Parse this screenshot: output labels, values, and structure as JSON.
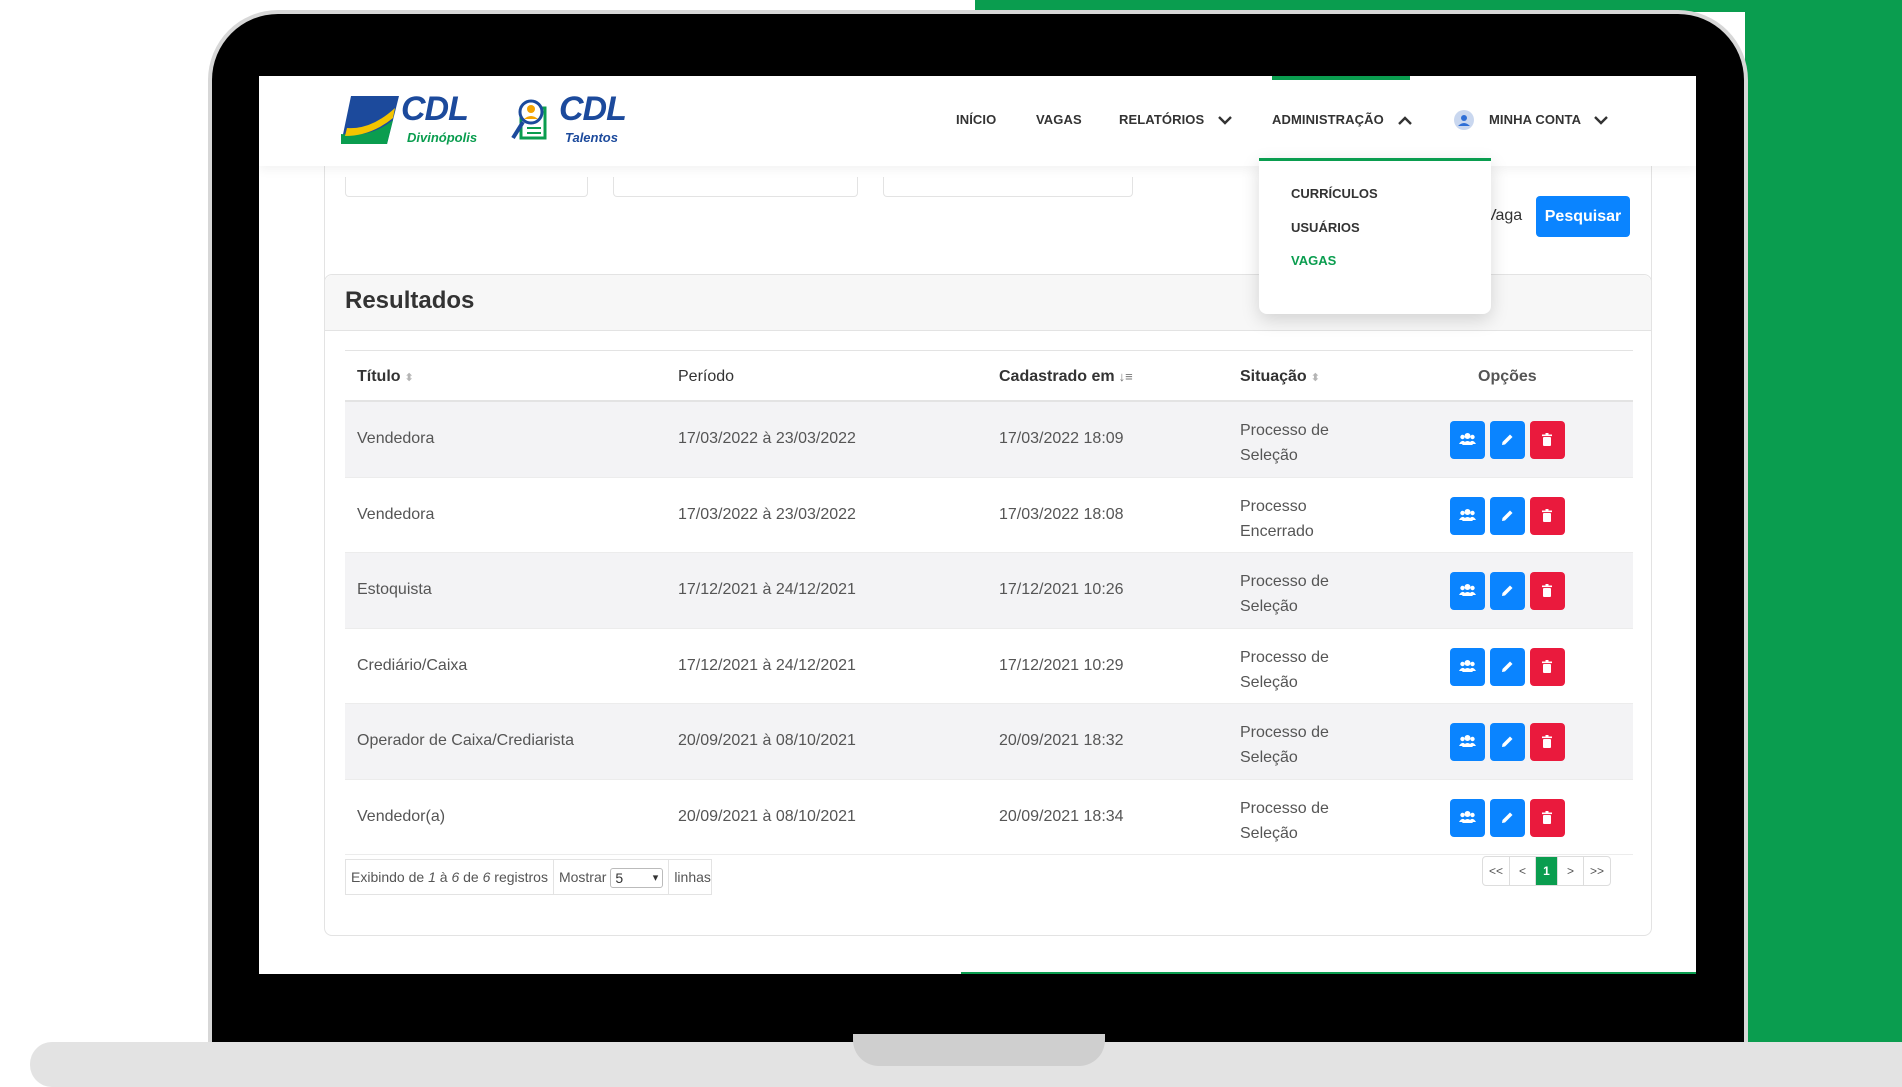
{
  "colors": {
    "brand_green": "#0a9d4f",
    "primary_blue": "#0a84ff",
    "danger_red": "#ea1a3d"
  },
  "logo": {
    "cdl1_text": "CDL",
    "cdl1_sub": "Divinópolis",
    "cdl2_text": "CDL",
    "cdl2_sub": "Talentos"
  },
  "nav": {
    "inicio": "INÍCIO",
    "vagas": "VAGAS",
    "relatorios": "RELATÓRIOS",
    "administracao": "ADMINISTRAÇÃO",
    "minha_conta": "MINHA CONTA"
  },
  "dropdown": {
    "items": [
      {
        "label": "CURRÍCULOS"
      },
      {
        "label": "USUÁRIOS"
      },
      {
        "label": "VAGAS",
        "active": true
      }
    ]
  },
  "filter": {
    "partial_label": "Vaga",
    "search_button": "Pesquisar"
  },
  "results": {
    "title": "Resultados",
    "columns": {
      "titulo": "Título",
      "periodo": "Período",
      "cadastrado": "Cadastrado em",
      "situacao": "Situação",
      "opcoes": "Opções"
    },
    "rows": [
      {
        "titulo": "Vendedora",
        "periodo": "17/03/2022 à 23/03/2022",
        "cadastrado": "17/03/2022 18:09",
        "situacao1": "Processo de",
        "situacao2": "Seleção"
      },
      {
        "titulo": "Vendedora",
        "periodo": "17/03/2022 à 23/03/2022",
        "cadastrado": "17/03/2022 18:08",
        "situacao1": "Processo",
        "situacao2": "Encerrado"
      },
      {
        "titulo": "Estoquista",
        "periodo": "17/12/2021 à 24/12/2021",
        "cadastrado": "17/12/2021 10:26",
        "situacao1": "Processo de",
        "situacao2": "Seleção"
      },
      {
        "titulo": "Crediário/Caixa",
        "periodo": "17/12/2021 à 24/12/2021",
        "cadastrado": "17/12/2021 10:29",
        "situacao1": "Processo de",
        "situacao2": "Seleção"
      },
      {
        "titulo": "Operador de Caixa/Crediarista",
        "periodo": "20/09/2021 à 08/10/2021",
        "cadastrado": "20/09/2021 18:32",
        "situacao1": "Processo de",
        "situacao2": "Seleção"
      },
      {
        "titulo": "Vendedor(a)",
        "periodo": "20/09/2021 à 08/10/2021",
        "cadastrado": "20/09/2021 18:34",
        "situacao1": "Processo de",
        "situacao2": "Seleção"
      }
    ],
    "option_icons": [
      "users-icon",
      "edit-icon",
      "trash-icon"
    ]
  },
  "footer": {
    "exibindo": "Exibindo de",
    "from": "1",
    "a": "à",
    "to": "6",
    "de": "de",
    "total": "6",
    "registros": "registros",
    "mostrar": "Mostrar",
    "per_page": "5",
    "linhas": "linhas"
  },
  "pagination": {
    "first": "<<",
    "prev": "<",
    "current": "1",
    "next": ">",
    "last": ">>"
  }
}
